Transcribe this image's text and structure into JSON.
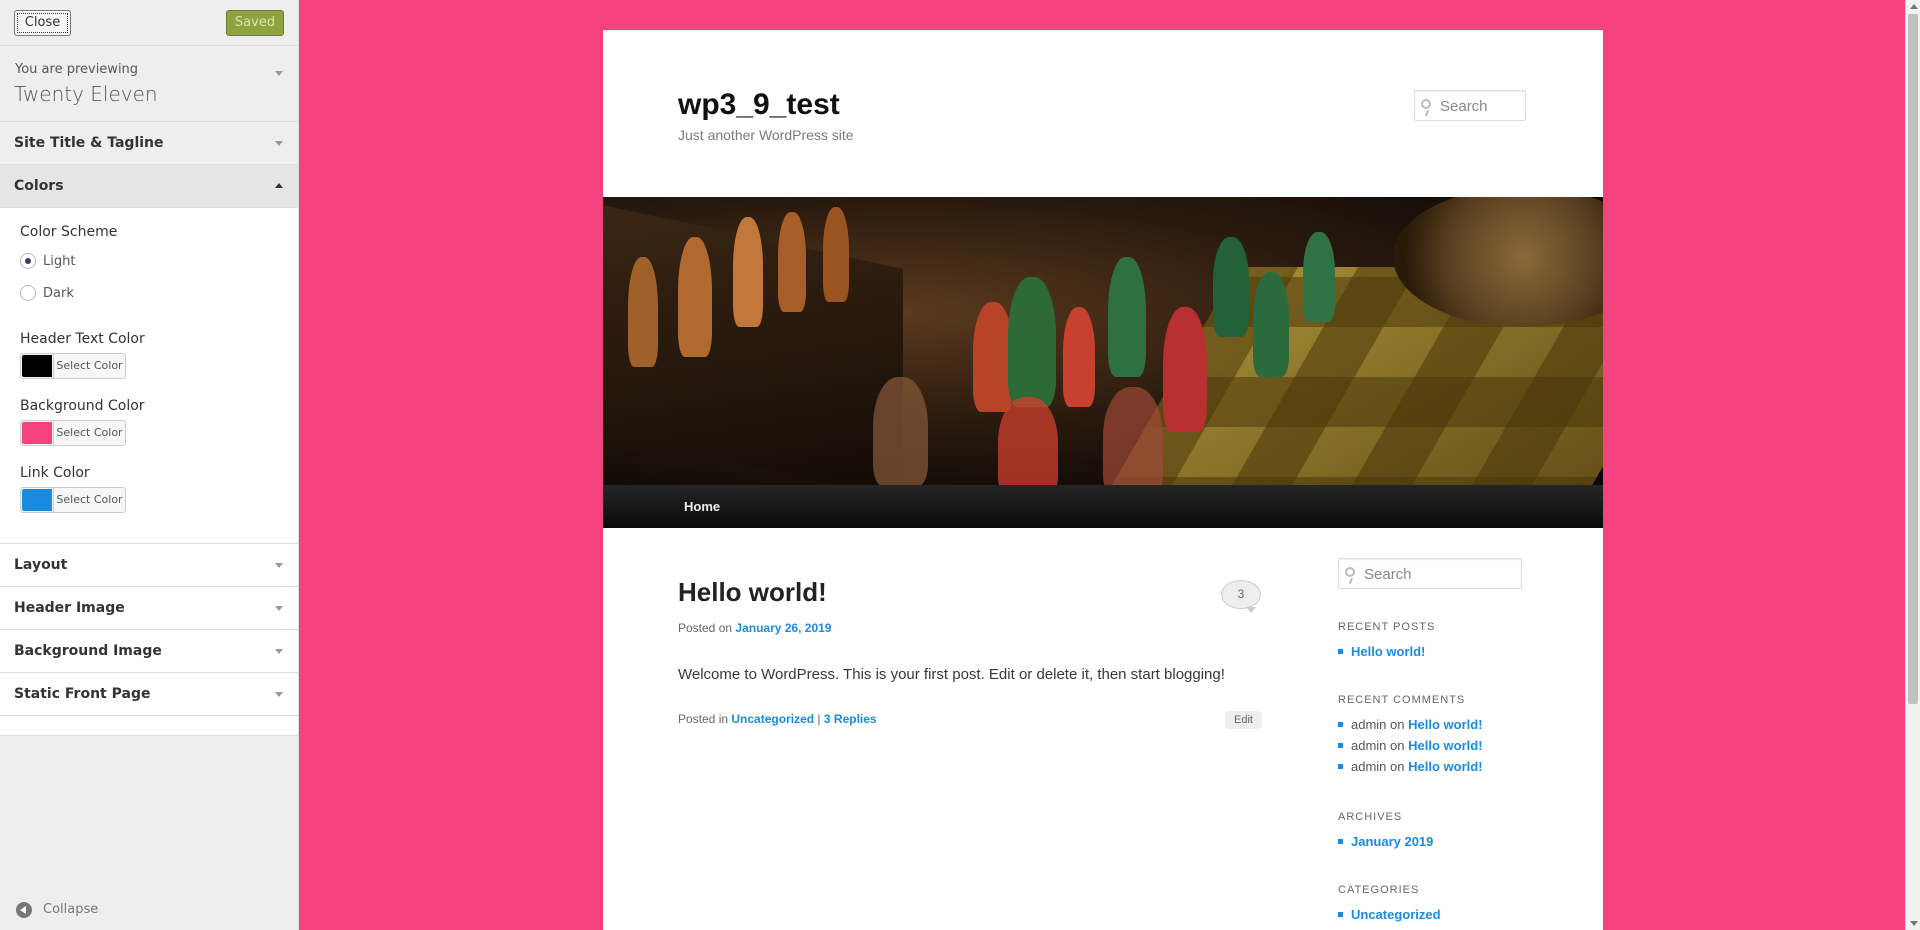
{
  "sidebar": {
    "close_label": "Close",
    "saved_label": "Saved",
    "previewing_label": "You are previewing",
    "theme_name": "Twenty Eleven",
    "sections": {
      "site_title": "Site Title & Tagline",
      "colors": "Colors",
      "layout": "Layout",
      "header_image": "Header Image",
      "background_image": "Background Image",
      "static_front_page": "Static Front Page"
    },
    "colors": {
      "scheme_title": "Color Scheme",
      "scheme_options": [
        "Light",
        "Dark"
      ],
      "scheme_selected": "Light",
      "header_text_title": "Header Text Color",
      "header_text_color": "#000000",
      "background_title": "Background Color",
      "background_color": "#f4427f",
      "link_title": "Link Color",
      "link_color": "#1b8be0",
      "select_color_label": "Select Color"
    },
    "collapse_label": "Collapse"
  },
  "site": {
    "title": "wp3_9_test",
    "tagline": "Just another WordPress site",
    "search_placeholder": "Search",
    "nav_home": "Home",
    "post": {
      "title": "Hello world!",
      "comment_count": "3",
      "posted_on": "Posted on",
      "date": "January 26, 2019",
      "body": "Welcome to WordPress. This is your first post. Edit or delete it, then start blogging!",
      "posted_in": "Posted in",
      "category": "Uncategorized",
      "separator": "|",
      "replies": "3 Replies",
      "edit": "Edit"
    },
    "widgets": {
      "search_placeholder": "Search",
      "recent_posts_title": "RECENT POSTS",
      "recent_posts": [
        "Hello world!"
      ],
      "recent_comments_title": "RECENT COMMENTS",
      "recent_comments": [
        {
          "author": "admin",
          "on": "on",
          "post": "Hello world!"
        },
        {
          "author": "admin",
          "on": "on",
          "post": "Hello world!"
        },
        {
          "author": "admin",
          "on": "on",
          "post": "Hello world!"
        }
      ],
      "archives_title": "ARCHIVES",
      "archives": [
        "January 2019"
      ],
      "categories_title": "CATEGORIES",
      "categories": [
        "Uncategorized"
      ]
    }
  },
  "colors": {
    "page_background": "#f4427f",
    "link": "#1b8be0",
    "saved_button": "#8ea23f"
  }
}
